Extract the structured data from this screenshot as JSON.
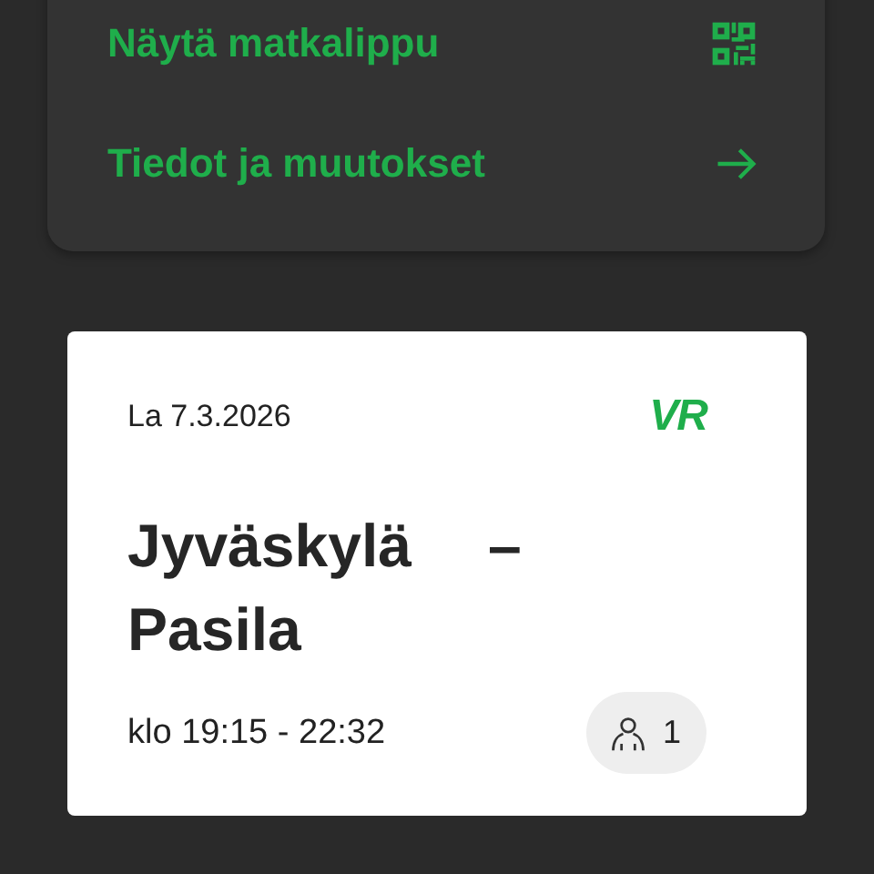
{
  "actions": [
    {
      "label": "Näytä matkalippu",
      "kind": "ticket"
    },
    {
      "label": "Tiedot ja muutokset",
      "kind": "link"
    }
  ],
  "ticket": {
    "date": "La 7.3.2026",
    "logo": "VR",
    "origin": "Jyväskylä",
    "separator": "–",
    "destination": "Pasila",
    "time": "klo 19:15 - 22:32",
    "passengers": "1"
  }
}
